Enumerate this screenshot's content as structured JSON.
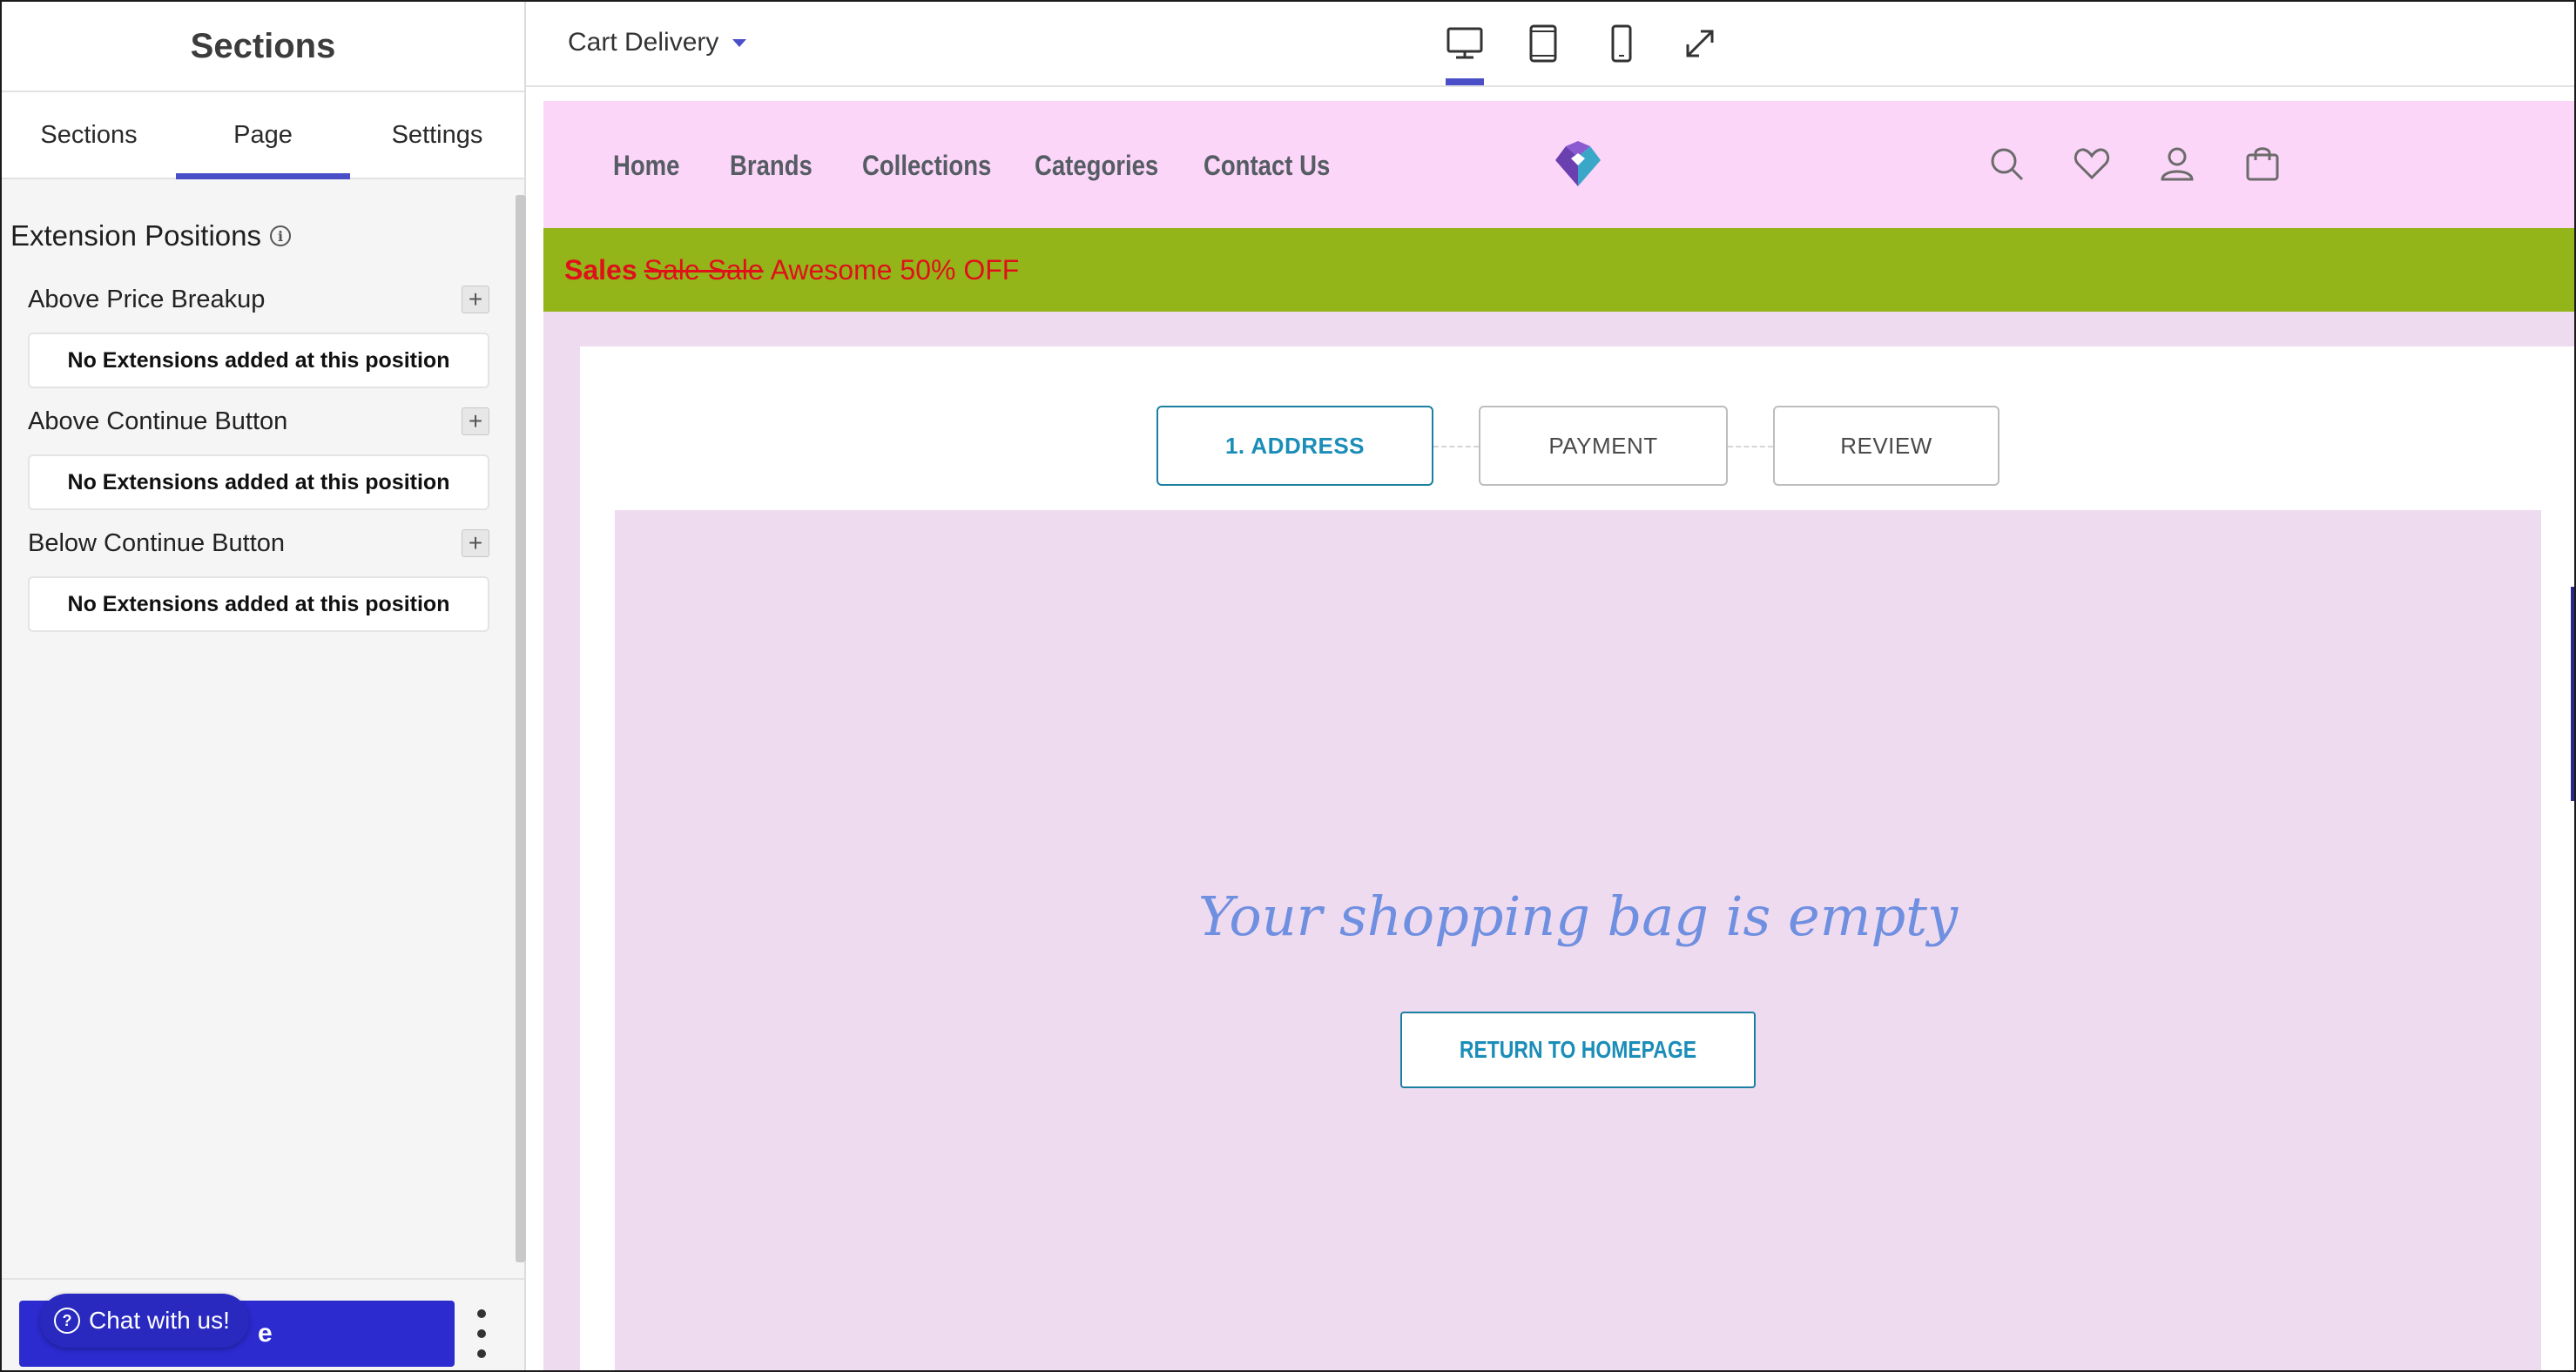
{
  "left_panel": {
    "title": "Sections",
    "tabs": [
      {
        "label": "Sections",
        "active": false
      },
      {
        "label": "Page",
        "active": true
      },
      {
        "label": "Settings",
        "active": false
      }
    ],
    "extension_heading": "Extension Positions",
    "positions": [
      {
        "label": "Above Price Breakup",
        "empty_text": "No Extensions added at this position"
      },
      {
        "label": "Above Continue Button",
        "empty_text": "No Extensions added at this position"
      },
      {
        "label": "Below Continue Button",
        "empty_text": "No Extensions added at this position"
      }
    ],
    "publish_label": "e",
    "chat_label": "Chat with us!"
  },
  "topbar": {
    "page_name": "Cart Delivery",
    "devices": [
      "desktop-icon",
      "tablet-icon",
      "mobile-icon",
      "fullscreen-icon"
    ],
    "active_device": "desktop-icon"
  },
  "preview": {
    "nav_links": [
      "Home",
      "Brands",
      "Collections",
      "Categories",
      "Contact Us"
    ],
    "nav_icons": [
      "search-icon",
      "heart-icon",
      "user-icon",
      "cart-bag-icon"
    ],
    "promo": {
      "bold": "Sales",
      "strike": "Sale Sale",
      "rest": "Awesome 50% OFF"
    },
    "steps": [
      {
        "label": "1. ADDRESS",
        "active": true
      },
      {
        "label": "PAYMENT",
        "active": false
      },
      {
        "label": "REVIEW",
        "active": false
      }
    ],
    "empty_message": "Your shopping bag is empty",
    "return_button": "RETURN TO HOMEPAGE"
  },
  "colors": {
    "accent": "#4a4fc8",
    "publish": "#2b2bd0",
    "nav_bg": "#fbd6f8",
    "promo_bg": "#93b51a",
    "promo_text": "#e0101a",
    "page_bg": "#efdbef",
    "step_active": "#1a8db8",
    "empty_title": "#6f8fe0"
  }
}
